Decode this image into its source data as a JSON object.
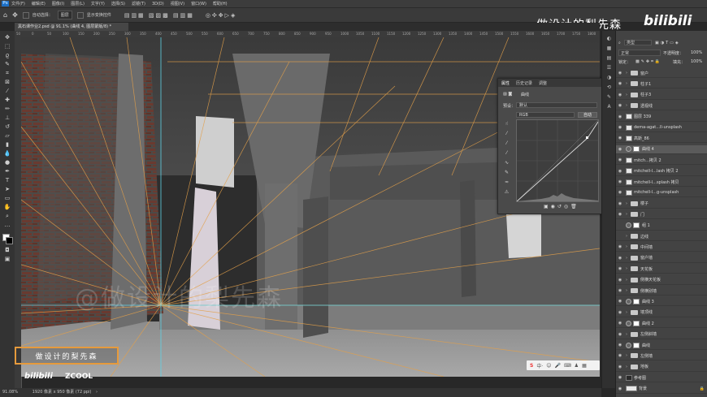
{
  "menu": {
    "logo": "Ps",
    "items": [
      "文件(F)",
      "编辑(E)",
      "图像(I)",
      "图层(L)",
      "文字(Y)",
      "选择(S)",
      "滤镜(T)",
      "3D(D)",
      "视图(V)",
      "窗口(W)",
      "帮助(H)"
    ]
  },
  "options": {
    "auto_select_label": "自动选择：",
    "auto_select_value": "图层",
    "show_transform_label": "显示变换控件"
  },
  "document_tab": "黑石课作业2.psd @ 91.1% (曲线 4, 图层蒙版/8) *",
  "ruler_ticks": [
    "50",
    "0",
    "50",
    "100",
    "150",
    "200",
    "250",
    "300",
    "350",
    "400",
    "450",
    "500",
    "550",
    "600",
    "650",
    "700",
    "750",
    "800",
    "850",
    "900",
    "950",
    "1000",
    "1050",
    "1100",
    "1150",
    "1200",
    "1250",
    "1300",
    "1350",
    "1400",
    "1450",
    "1500",
    "1550",
    "1600",
    "1650",
    "1700",
    "1750",
    "1800"
  ],
  "status": {
    "zoom": "91.08%",
    "doc_size": "1920 像素 x 950 像素 (72 ppi)"
  },
  "properties_panel": {
    "tabs": [
      "属性",
      "历史记录",
      "调整"
    ],
    "title": "曲线",
    "preset_label": "预设：",
    "preset_value": "默认",
    "channel_value": "RGB",
    "auto_label": "自动"
  },
  "layers_panel": {
    "search_kind": "类型",
    "blend_mode": "正常",
    "opacity_label": "不透明度：",
    "opacity_value": "100%",
    "lock_label": "锁定：",
    "fill_label": "填充：",
    "fill_value": "100%",
    "layers": [
      {
        "name": "窗户",
        "kind": "group",
        "visible": true,
        "selected": false
      },
      {
        "name": "柱子1",
        "kind": "group",
        "visible": true,
        "selected": false
      },
      {
        "name": "柱子3",
        "kind": "group",
        "visible": true,
        "selected": false
      },
      {
        "name": "透视线",
        "kind": "group",
        "visible": true,
        "selected": false
      },
      {
        "name": "图层 339",
        "kind": "pixel",
        "visible": true,
        "selected": false
      },
      {
        "name": "dema-agat...ll-unsplash",
        "kind": "pixel",
        "visible": true,
        "selected": false
      },
      {
        "name": "高斯_86",
        "kind": "pixel",
        "visible": true,
        "selected": false
      },
      {
        "name": "曲线 4",
        "kind": "adjust",
        "visible": true,
        "selected": true
      },
      {
        "name": "mitch...拷贝 2",
        "kind": "pixel",
        "visible": true,
        "selected": false
      },
      {
        "name": "mitchell-l...lash 拷贝 2",
        "kind": "pixel",
        "visible": true,
        "selected": false
      },
      {
        "name": "mitchell-l...splash 拷贝",
        "kind": "pixel",
        "visible": true,
        "selected": false
      },
      {
        "name": "mitchell-l...g-unsplash",
        "kind": "pixel",
        "visible": true,
        "selected": false
      },
      {
        "name": "楼子",
        "kind": "group",
        "visible": true,
        "selected": false
      },
      {
        "name": "门",
        "kind": "group",
        "visible": true,
        "selected": false
      },
      {
        "name": "组 1",
        "kind": "adjust",
        "visible": false,
        "selected": false
      },
      {
        "name": "边线",
        "kind": "group",
        "visible": false,
        "selected": false
      },
      {
        "name": "中间墙",
        "kind": "group",
        "visible": true,
        "selected": false
      },
      {
        "name": "窗户墙",
        "kind": "group",
        "visible": true,
        "selected": false
      },
      {
        "name": "天花板",
        "kind": "group",
        "visible": true,
        "selected": false
      },
      {
        "name": "侧横天花板",
        "kind": "group",
        "visible": true,
        "selected": false
      },
      {
        "name": "侧横别墙",
        "kind": "group",
        "visible": true,
        "selected": false
      },
      {
        "name": "曲线 3",
        "kind": "adjust",
        "visible": true,
        "selected": false
      },
      {
        "name": "墙顶线",
        "kind": "group",
        "visible": true,
        "selected": false
      },
      {
        "name": "曲线 2",
        "kind": "adjust",
        "visible": true,
        "selected": false
      },
      {
        "name": "左侧斜墙",
        "kind": "group",
        "visible": true,
        "selected": false
      },
      {
        "name": "曲线",
        "kind": "adjust",
        "visible": true,
        "selected": false
      },
      {
        "name": "左侧墙",
        "kind": "group",
        "visible": true,
        "selected": false
      },
      {
        "name": "地板",
        "kind": "group",
        "visible": true,
        "selected": false
      },
      {
        "name": "参考图",
        "kind": "pixel-dark",
        "visible": true,
        "selected": false
      },
      {
        "name": "背景",
        "kind": "background",
        "visible": true,
        "selected": false
      }
    ]
  },
  "watermark": {
    "title": "做设计的梨先森",
    "bilibili": "bilibili",
    "canvas_text": "@做设计的梨先森",
    "brand_box": "做设计的梨先森",
    "bili_small": "bilibili",
    "zcool": "ZCOOL"
  },
  "ime_bar": {
    "logo": "S",
    "label": "中·"
  }
}
